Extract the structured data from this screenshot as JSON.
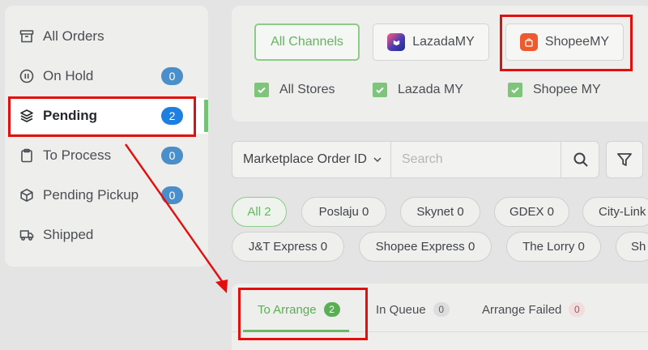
{
  "sidebar": {
    "items": [
      {
        "label": "All Orders",
        "icon": "archive-icon",
        "badge": null
      },
      {
        "label": "On Hold",
        "icon": "pause-circle-icon",
        "badge": "0"
      },
      {
        "label": "Pending",
        "icon": "layers-icon",
        "badge": "2"
      },
      {
        "label": "To Process",
        "icon": "clipboard-icon",
        "badge": "0"
      },
      {
        "label": "Pending Pickup",
        "icon": "box-icon",
        "badge": "0"
      },
      {
        "label": "Shipped",
        "icon": "truck-icon",
        "badge": null
      }
    ],
    "active_index": 2
  },
  "channels": {
    "buttons": [
      {
        "label": "All Channels"
      },
      {
        "label": "LazadaMY",
        "icon": "lazada-logo-icon"
      },
      {
        "label": "ShopeeMY",
        "icon": "shopee-logo-icon"
      }
    ],
    "stores": [
      "All Stores",
      "Lazada MY",
      "Shopee MY"
    ]
  },
  "search": {
    "field_select": "Marketplace Order ID",
    "placeholder": "Search"
  },
  "couriers": [
    "All 2",
    "Poslaju 0",
    "Skynet 0",
    "GDEX 0",
    "City-Link",
    "J&T Express 0",
    "Shopee Express 0",
    "The Lorry 0",
    "Sh"
  ],
  "tabs": [
    {
      "label": "To Arrange",
      "count": "2"
    },
    {
      "label": "In Queue",
      "count": "0"
    },
    {
      "label": "Arrange Failed",
      "count": "0"
    }
  ],
  "colors": {
    "accent_green": "#5aaf55",
    "badge_blue": "#1d7fe0",
    "highlight_red": "#e60d0d"
  }
}
